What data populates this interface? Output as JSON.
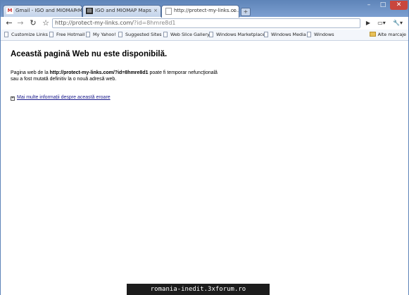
{
  "tabs": [
    {
      "title": "Gmail - IGO and MIOMAP M...",
      "favicon": "gmail-icon",
      "close": "×",
      "active": false
    },
    {
      "title": "IGO and MIOMAP Maps",
      "favicon": "forum-icon",
      "close": "×",
      "active": false
    },
    {
      "title": "http://protect-my-links.co...",
      "favicon": "page-icon",
      "close": "×",
      "active": true
    }
  ],
  "new_tab_glyph": "+",
  "window_controls": {
    "minimize": "–",
    "maximize": "□",
    "close": "✕"
  },
  "toolbar": {
    "back": "←",
    "forward": "→",
    "reload": "↻",
    "star": "☆",
    "url_host": "http://protect-my-links.com/",
    "url_rest": "?id=8hmre8d1",
    "go": "▶",
    "page_menu": "▭▾",
    "tools_menu": "🔧▾"
  },
  "bookmarks": [
    "Customize Links",
    "Free Hotmail",
    "My Yahoo!",
    "Suggested Sites",
    "Web Slice Gallery",
    "Windows Marketplace",
    "Windows Media",
    "Windows"
  ],
  "other_bookmarks": "Alte marcaje",
  "error": {
    "heading": "Această pagină Web nu este disponibilă.",
    "msg_prefix": "Pagina web de la ",
    "msg_url": "http://protect-my-links.com/?id=8hmre8d1",
    "msg_suffix": " poate fi temporar nefuncţională sau a fost mutată definitiv la o nouă adresă web.",
    "more_link": "Mai multe informații despre această eroare"
  },
  "watermark": "romania-inedit.3xforum.ro",
  "colors": {
    "titlebar": "#5e84b8",
    "link": "#1a1a8c"
  }
}
